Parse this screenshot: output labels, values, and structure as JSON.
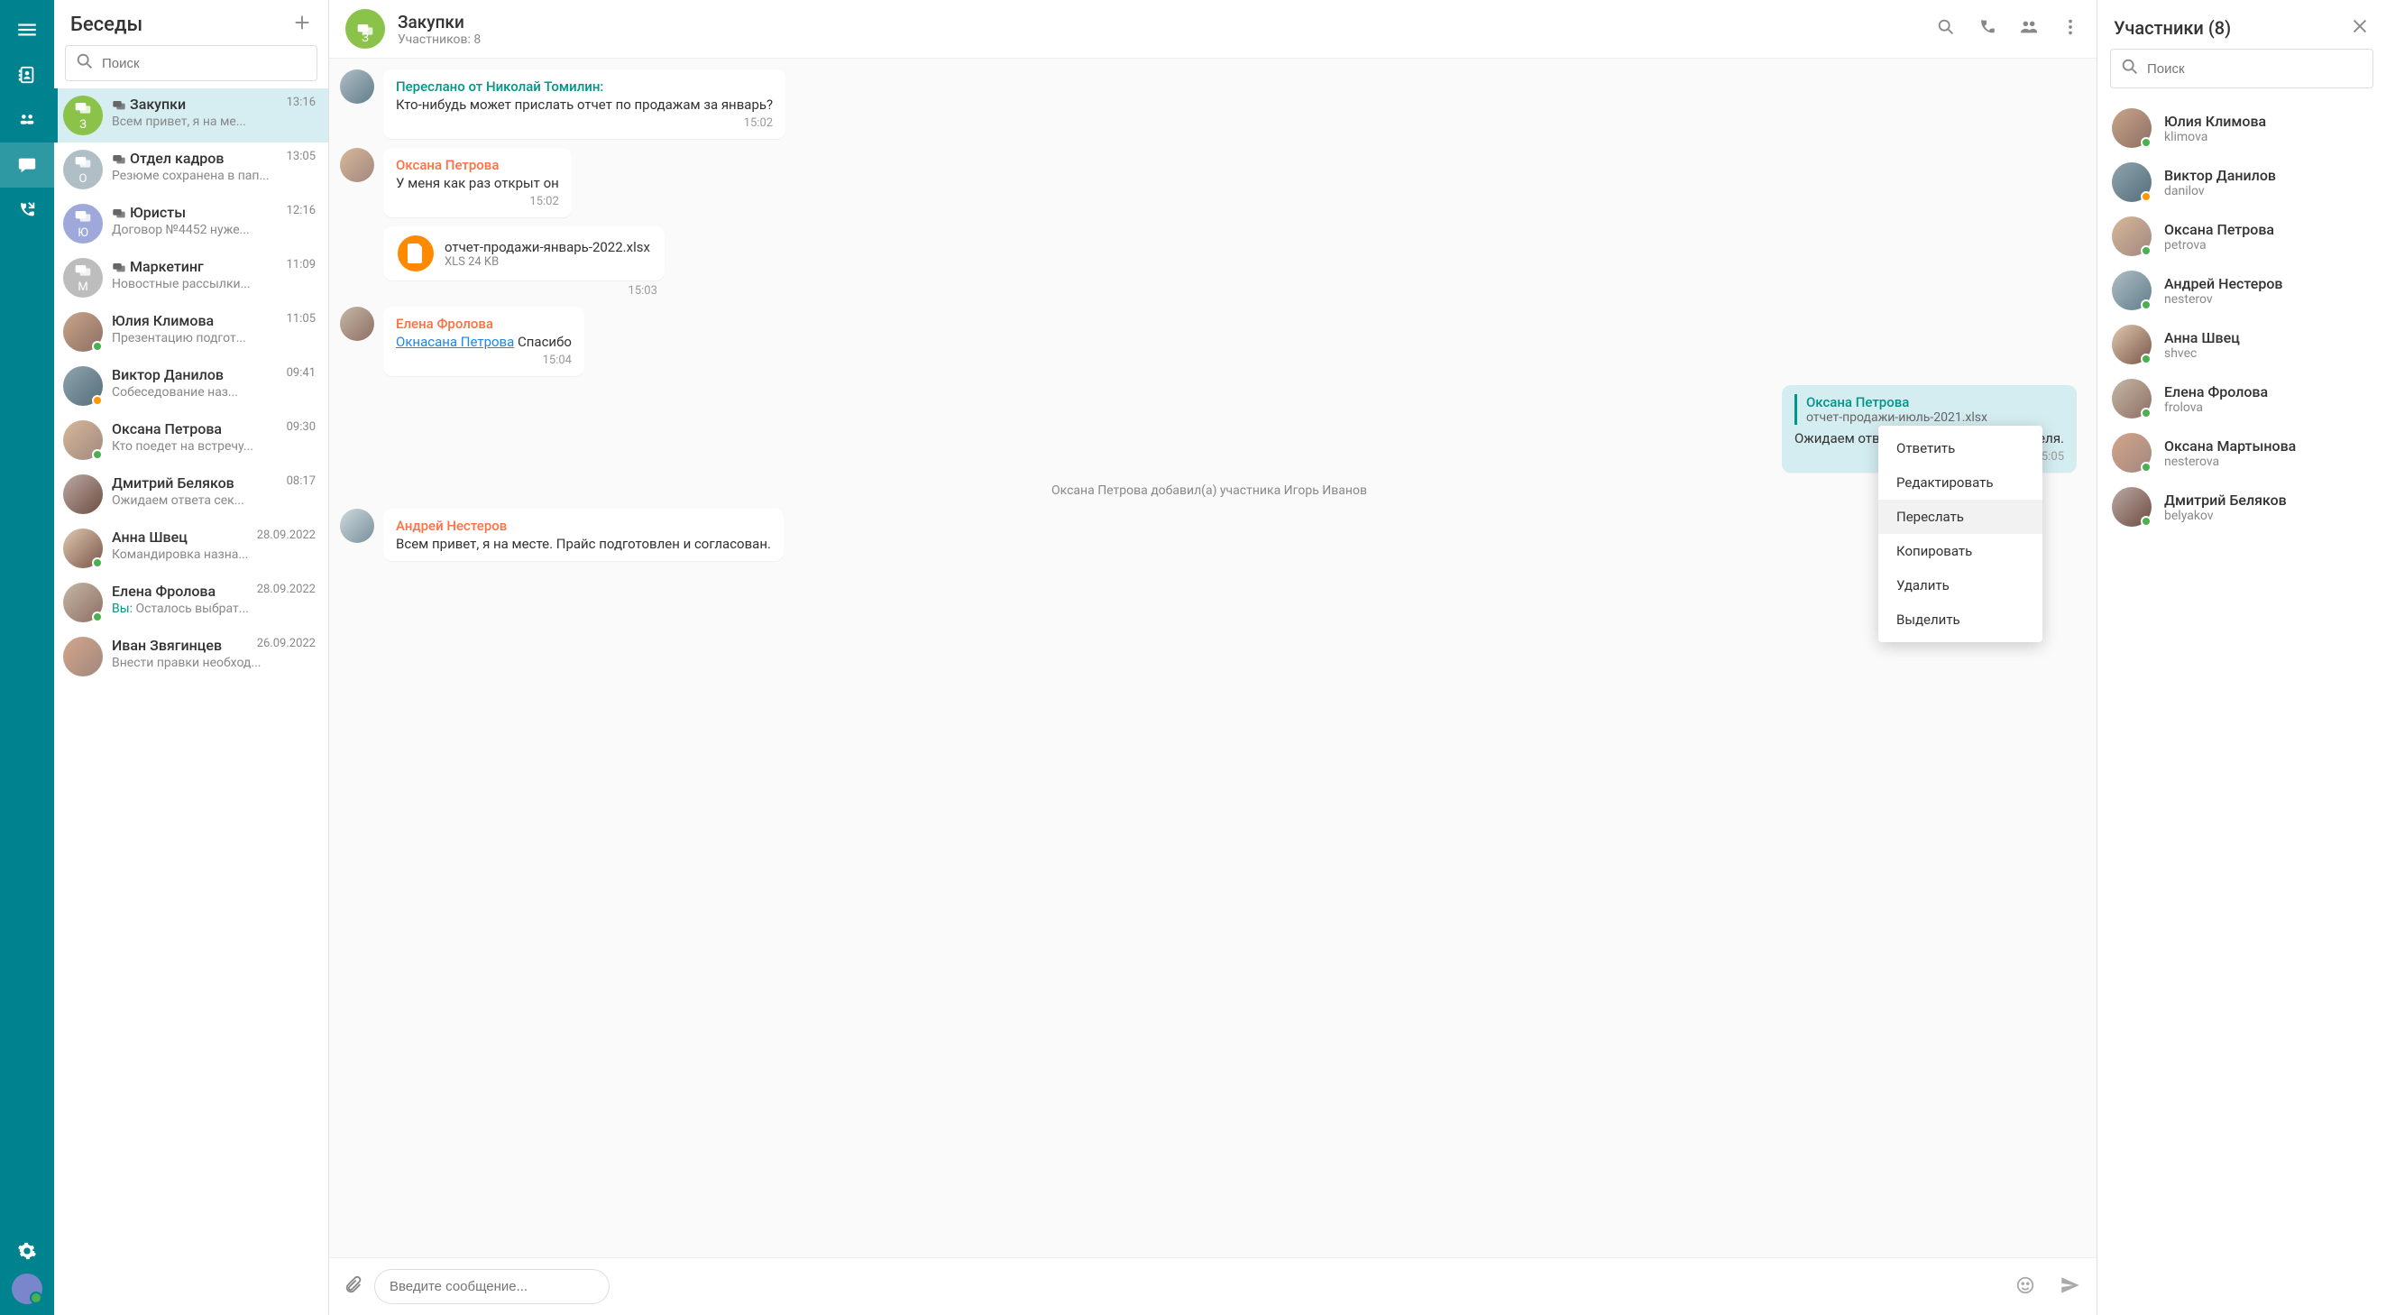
{
  "sidebar": {
    "title": "Беседы",
    "search_placeholder": "Поиск"
  },
  "conversations": [
    {
      "title": "Закупки",
      "preview": "Всем привет, я на ме...",
      "time": "13:16",
      "avatar_letter": "З",
      "avatar_color": "#8bc34a",
      "group": true,
      "active": true
    },
    {
      "title": "Отдел кадров",
      "preview": "Резюме сохранена в пап...",
      "time": "13:05",
      "avatar_letter": "О",
      "avatar_color": "#b0bec5",
      "group": true
    },
    {
      "title": "Юристы",
      "preview": "Договор №4452 нуже...",
      "time": "12:16",
      "avatar_letter": "Ю",
      "avatar_color": "#9fa8da",
      "group": true
    },
    {
      "title": "Маркетинг",
      "preview": "Новостные рассылки...",
      "time": "11:09",
      "avatar_letter": "М",
      "avatar_color": "#bdbdbd",
      "group": true
    },
    {
      "title": "Юлия Климова",
      "preview": "Презентацию подгот...",
      "time": "11:05",
      "avatar_class": "ph1",
      "presence": "green"
    },
    {
      "title": "Виктор Данилов",
      "preview": "Собеседование наз...",
      "time": "09:41",
      "avatar_class": "ph2",
      "presence": "orange"
    },
    {
      "title": "Оксана Петрова",
      "preview": "Кто поедет на встречу...",
      "time": "09:30",
      "avatar_class": "ph3",
      "presence": "green"
    },
    {
      "title": "Дмитрий Беляков",
      "preview": "Ожидаем ответа сек...",
      "time": "08:17",
      "avatar_class": "ph4"
    },
    {
      "title": "Анна Швец",
      "preview": "Командировка назна...",
      "time": "28.09.2022",
      "avatar_class": "ph5",
      "presence": "green"
    },
    {
      "title": "Елена Фролова",
      "preview_prefix": "Вы: ",
      "preview": "Осталось выбрат...",
      "time": "28.09.2022",
      "avatar_class": "ph6",
      "presence": "green"
    },
    {
      "title": "Иван Звягинцев",
      "preview": "Внести правки необход...",
      "time": "26.09.2022",
      "avatar_class": "ph7"
    }
  ],
  "chat": {
    "title": "Закупки",
    "subtitle": "Участников: 8",
    "avatar_letter": "З",
    "composer_placeholder": "Введите сообщение..."
  },
  "messages": {
    "m1_fwd": "Переслано от Николай Томилин:",
    "m1_text": "Кто-нибудь может прислать отчет по продажам за январь?",
    "m1_time": "15:02",
    "m2_author": "Оксана Петрова",
    "m2_text": "У меня как раз открыт он",
    "m2_time": "15:02",
    "m3_file_name": "отчет-продажи-январь-2022.xlsx",
    "m3_file_meta": "XLS 24 KB",
    "m3_time": "15:03",
    "m4_author": "Елена Фролова",
    "m4_mention": "Окнасана Петрова",
    "m4_text": " Спасибо",
    "m4_time": "15:04",
    "m5_quote_author": "Оксана Петрова",
    "m5_quote_text": "отчет-продажи-июль-2021.xlsx",
    "m5_text": "Ожидаем ответа секретаря руководителя.",
    "m5_time": "15:05",
    "system": "Оксана Петрова добавил(а) участника Игорь Иванов",
    "m6_author": "Андрей Нестеров",
    "m6_text": "Всем привет, я на месте. Прайс подготовлен и согласован."
  },
  "context_menu": {
    "items": [
      "Ответить",
      "Редактировать",
      "Переслать",
      "Копировать",
      "Удалить",
      "Выделить"
    ],
    "hover_index": 2
  },
  "participants_panel": {
    "title": "Участники (8)",
    "search_placeholder": "Поиск"
  },
  "participants": [
    {
      "name": "Юлия Климова",
      "login": "klimova",
      "avatar_class": "ph1",
      "presence": "green"
    },
    {
      "name": "Виктор Данилов",
      "login": "danilov",
      "avatar_class": "ph2",
      "presence": "orange"
    },
    {
      "name": "Оксана Петрова",
      "login": "petrova",
      "avatar_class": "ph3",
      "presence": "green"
    },
    {
      "name": "Андрей Нестеров",
      "login": "nesterov",
      "avatar_class": "ph8",
      "presence": "green"
    },
    {
      "name": "Анна Швец",
      "login": "shvec",
      "avatar_class": "ph5",
      "presence": "green"
    },
    {
      "name": "Елена Фролова",
      "login": "frolova",
      "avatar_class": "ph6",
      "presence": "green"
    },
    {
      "name": "Оксана Мартынова",
      "login": "nesterova",
      "avatar_class": "ph7",
      "presence": "green"
    },
    {
      "name": "Дмитрий Беляков",
      "login": "belyakov",
      "avatar_class": "ph4",
      "presence": "green"
    }
  ]
}
